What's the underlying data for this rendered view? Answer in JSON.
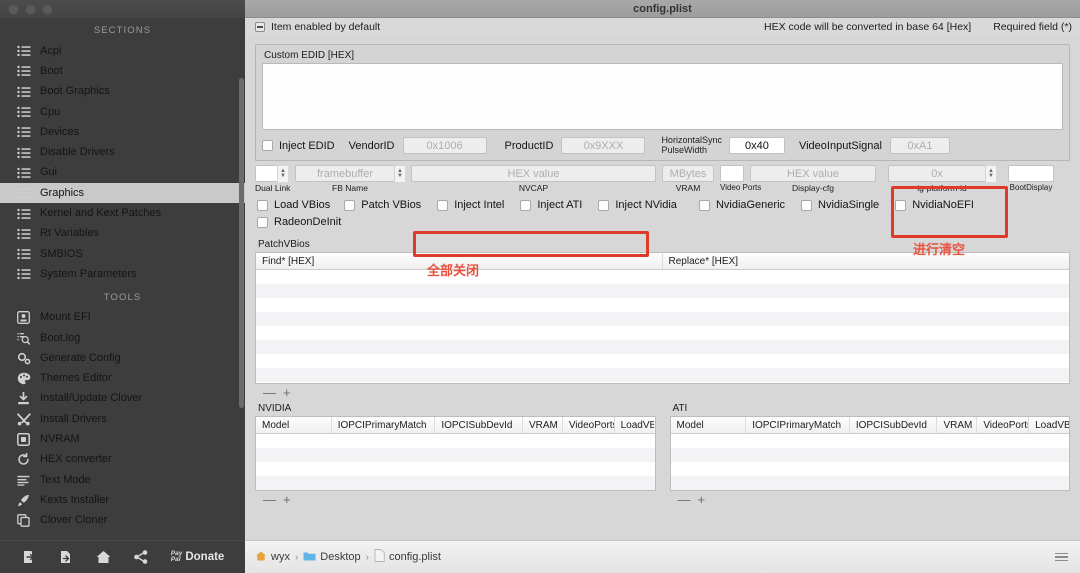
{
  "window": {
    "title": "config.plist"
  },
  "sidebar": {
    "sections_header": "SECTIONS",
    "tools_header": "TOOLS",
    "sections": [
      {
        "label": "Acpi",
        "icon": "list-icon"
      },
      {
        "label": "Boot",
        "icon": "list-icon"
      },
      {
        "label": "Boot Graphics",
        "icon": "list-icon"
      },
      {
        "label": "Cpu",
        "icon": "list-icon"
      },
      {
        "label": "Devices",
        "icon": "list-icon"
      },
      {
        "label": "Disable Drivers",
        "icon": "list-icon"
      },
      {
        "label": "Gui",
        "icon": "list-icon"
      },
      {
        "label": "Graphics",
        "icon": "list-icon",
        "selected": true
      },
      {
        "label": "Kernel and Kext Patches",
        "icon": "list-icon"
      },
      {
        "label": "Rt Variables",
        "icon": "list-icon"
      },
      {
        "label": "SMBIOS",
        "icon": "list-icon"
      },
      {
        "label": "System Parameters",
        "icon": "list-icon"
      }
    ],
    "tools": [
      {
        "label": "Mount EFI",
        "icon": "disk-icon"
      },
      {
        "label": "Boot.log",
        "icon": "log-search-icon"
      },
      {
        "label": "Generate Config",
        "icon": "gear-icon"
      },
      {
        "label": "Themes Editor",
        "icon": "palette-icon"
      },
      {
        "label": "Install/Update Clover",
        "icon": "download-icon"
      },
      {
        "label": "Install Drivers",
        "icon": "tools-icon"
      },
      {
        "label": "NVRAM",
        "icon": "chip-icon"
      },
      {
        "label": "HEX converter",
        "icon": "refresh-icon"
      },
      {
        "label": "Text Mode",
        "icon": "lines-icon"
      },
      {
        "label": "Kexts Installer",
        "icon": "rocket-icon"
      },
      {
        "label": "Clover Cloner",
        "icon": "copy-icon"
      }
    ],
    "bottom_bar": [
      {
        "name": "import-icon",
        "label": ""
      },
      {
        "name": "export-icon",
        "label": ""
      },
      {
        "name": "home-icon",
        "label": ""
      },
      {
        "name": "share-icon",
        "label": ""
      }
    ],
    "donate": {
      "paypal_line1": "Pay",
      "paypal_line2": "Pal",
      "label": "Donate"
    }
  },
  "toolbar": {
    "item_enabled": "Item enabled by default",
    "hex_note": "HEX code will be converted in base 64 [Hex]",
    "required_note": "Required field (*)"
  },
  "graphics": {
    "edid_group_label": "Custom EDID [HEX]",
    "edid_textarea_value": "",
    "inject_edid": {
      "label": "Inject EDID",
      "checked": false
    },
    "vendor_id": {
      "label": "VendorID",
      "placeholder": "0x1006",
      "value": ""
    },
    "product_id": {
      "label": "ProductID",
      "placeholder": "0x9XXX",
      "value": ""
    },
    "hsync": {
      "label_line1": "HorizontalSync",
      "label_line2": "PulseWidth",
      "value": "0x40"
    },
    "video_input_signal": {
      "label": "VideoInputSignal",
      "placeholder": "0xA1",
      "value": ""
    },
    "dual_link": {
      "label": "Dual Link",
      "value": ""
    },
    "fb_name": {
      "label": "FB Name",
      "placeholder": "framebuffer",
      "value": ""
    },
    "nvcap": {
      "label": "NVCAP",
      "placeholder": "HEX value",
      "value": ""
    },
    "vram": {
      "label": "VRAM",
      "placeholder": "MBytes",
      "value": ""
    },
    "video_ports": {
      "label": "Video Ports",
      "value": ""
    },
    "display_cfg": {
      "label": "Display-cfg",
      "placeholder": "HEX value",
      "value": ""
    },
    "ig_platform_id": {
      "label": "ig-platform-id",
      "placeholder": "0x",
      "value": ""
    },
    "boot_display": {
      "label": "BootDisplay",
      "value": ""
    },
    "checkboxes_row1": [
      {
        "label": "Load VBios",
        "checked": false
      },
      {
        "label": "Patch VBios",
        "checked": false
      },
      {
        "label": "Inject Intel",
        "checked": false
      },
      {
        "label": "Inject ATI",
        "checked": false
      },
      {
        "label": "Inject NVidia",
        "checked": false
      },
      {
        "label": "NvidiaGeneric",
        "checked": false
      },
      {
        "label": "NvidiaSingle",
        "checked": false
      },
      {
        "label": "NvidiaNoEFI",
        "checked": false
      }
    ],
    "checkboxes_row2": [
      {
        "label": "RadeonDeInit",
        "checked": false
      }
    ],
    "patch_vbios": {
      "label": "PatchVBios",
      "columns": [
        "Find* [HEX]",
        "Replace* [HEX]"
      ],
      "rows": []
    },
    "nvidia": {
      "label": "NVIDIA",
      "columns": [
        "Model",
        "IOPCIPrimaryMatch",
        "IOPCISubDevId",
        "VRAM",
        "VideoPorts",
        "LoadVBios"
      ],
      "rows": []
    },
    "ati": {
      "label": "ATI",
      "columns": [
        "Model",
        "IOPCIPrimaryMatch",
        "IOPCISubDevId",
        "VRAM",
        "VideoPorts",
        "LoadVBios"
      ],
      "rows": []
    },
    "minus_label": "—",
    "plus_label": "+"
  },
  "annotations": [
    {
      "name": "annotation-disable-all",
      "text": "全部关闭"
    },
    {
      "name": "annotation-clear-field",
      "text": "进行清空"
    }
  ],
  "statusbar": {
    "breadcrumb": [
      {
        "label": "wyx",
        "icon": "home-icon"
      },
      {
        "label": "Desktop",
        "icon": "folder-icon"
      },
      {
        "label": "config.plist",
        "icon": "file-icon"
      }
    ],
    "separator": "›",
    "menu_icon": "hamburger-icon"
  },
  "colors": {
    "accent_red": "#e03a28",
    "annotation_red": "#e8523f",
    "sidebar_bg": "#3d3d3d",
    "panel_bg": "#d7d7d7",
    "selected_row": "#c9c9c9"
  }
}
